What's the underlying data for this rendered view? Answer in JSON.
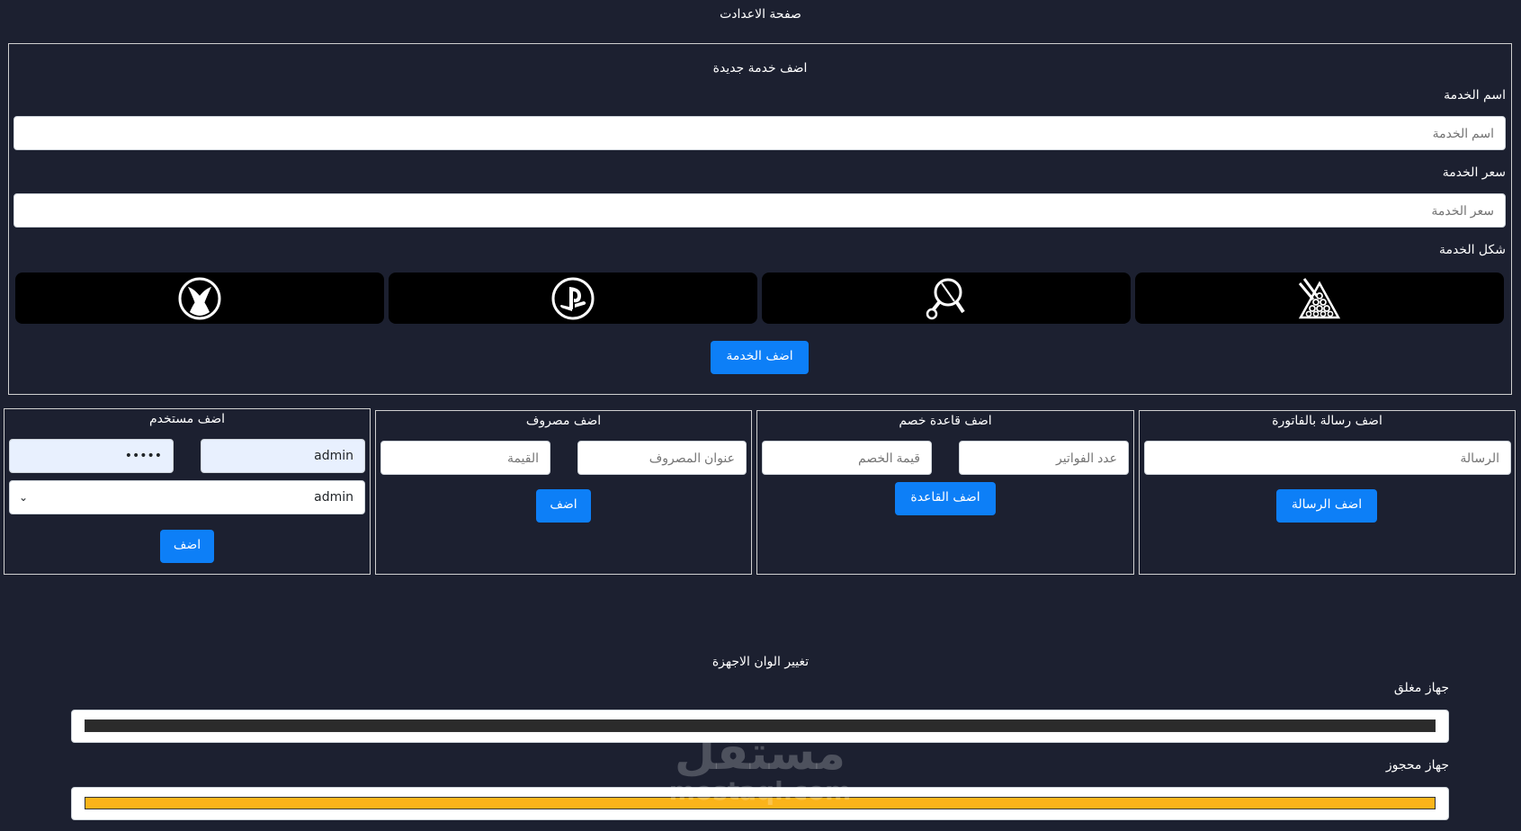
{
  "page": {
    "title": "صفحة الاعدادت"
  },
  "new_service": {
    "title": "اضف خدمة جديدة",
    "name_label": "اسم الخدمة",
    "name_placeholder": "اسم الخدمة",
    "price_label": "سعر الخدمة",
    "price_placeholder": "سعر الخدمة",
    "shape_label": "شكل الخدمة",
    "shapes": [
      "billiards-icon",
      "ping-pong-icon",
      "playstation-icon",
      "xbox-icon"
    ],
    "submit_label": "اضف الخدمة"
  },
  "invoice_message": {
    "title": "اضف رسالة بالفاتورة",
    "message_placeholder": "الرسالة",
    "submit_label": "اضف الرسالة"
  },
  "discount_rule": {
    "title": "اضف قاعدة خصم",
    "invoices_placeholder": "عدد الفواتير",
    "discount_placeholder": "قيمة الخصم",
    "submit_label": "اضف القاعدة"
  },
  "expense": {
    "title": "اضف مصروف",
    "title_placeholder": "عنوان المصروف",
    "value_placeholder": "القيمة",
    "submit_label": "اضف"
  },
  "user": {
    "title": "اضف مستخدم",
    "username_value": "admin",
    "password_value": "•••••",
    "role_value": "admin",
    "submit_label": "اضف"
  },
  "device_colors": {
    "title": "تغيير الوان الاجهزة",
    "closed_label": "جهاز مغلق",
    "closed_color": "#2b2b2b",
    "reserved_label": "جهاز محجوز",
    "reserved_color": "#fbb41a"
  },
  "watermark": {
    "text": "مستقل",
    "sub": "mostaql.com"
  }
}
